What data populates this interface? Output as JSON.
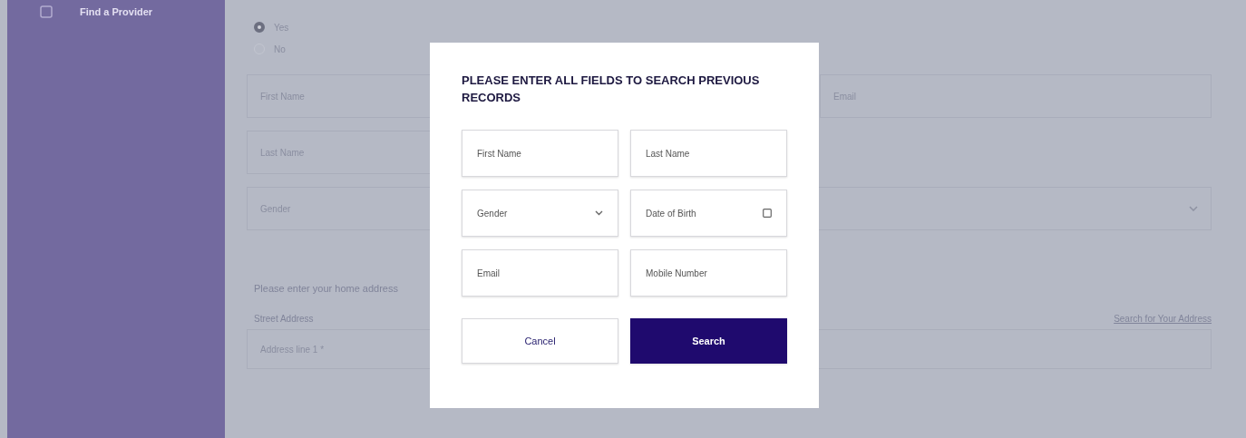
{
  "sidebar": {
    "items": [
      {
        "label": "Find a Provider"
      }
    ]
  },
  "form": {
    "radios": [
      {
        "label": "Yes",
        "selected": true
      },
      {
        "label": "No",
        "selected": false
      }
    ],
    "rows": [
      [
        {
          "kind": "text",
          "placeholder": "First Name"
        },
        {
          "kind": "text",
          "placeholder": "Email"
        }
      ],
      [
        {
          "kind": "text",
          "placeholder": "Last Name"
        }
      ],
      [
        {
          "kind": "select",
          "placeholder": "Gender"
        }
      ]
    ],
    "address_prompt": "Please enter your home address",
    "address_label": "Street Address",
    "address_link": "Search for Your Address",
    "address_fields": [
      {
        "placeholder": "Address line 1 *"
      }
    ]
  },
  "modal": {
    "title": "PLEASE ENTER ALL FIELDS TO SEARCH PREVIOUS RECORDS",
    "fields": [
      {
        "kind": "text",
        "placeholder": "First Name"
      },
      {
        "kind": "text",
        "placeholder": "Last Name"
      },
      {
        "kind": "select",
        "placeholder": "Gender"
      },
      {
        "kind": "date",
        "placeholder": "Date of Birth"
      },
      {
        "kind": "text",
        "placeholder": "Email"
      },
      {
        "kind": "text",
        "placeholder": "Mobile Number"
      }
    ],
    "buttons": [
      {
        "kind": "secondary",
        "label": "Cancel"
      },
      {
        "kind": "primary",
        "label": "Search"
      }
    ]
  }
}
